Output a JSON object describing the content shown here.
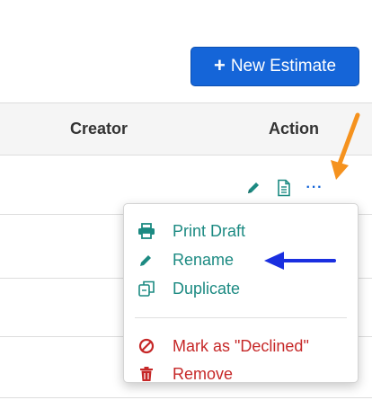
{
  "toolbar": {
    "new_estimate_label": "New Estimate",
    "new_estimate_icon": "plus-icon",
    "accent": "#1565d8"
  },
  "table": {
    "columns": [
      "Creator",
      "Action"
    ]
  },
  "row_actions": {
    "icons": [
      "pencil-icon",
      "document-icon",
      "more-icon"
    ],
    "more_label": "···"
  },
  "dropdown": {
    "items": [
      {
        "label": "Print Draft",
        "icon": "printer-icon",
        "color": "#1c8a82"
      },
      {
        "label": "Rename",
        "icon": "pencil-icon",
        "color": "#1c8a82"
      },
      {
        "label": "Duplicate",
        "icon": "copy-icon",
        "color": "#1c8a82"
      },
      {
        "label": "Mark as \"Declined\"",
        "icon": "prohibited-icon",
        "color": "#c62828"
      },
      {
        "label": "Remove",
        "icon": "trash-icon",
        "color": "#c62828"
      }
    ]
  },
  "annotations": {
    "orange_arrow_color": "#f5921e",
    "blue_arrow_color": "#1a2fe0"
  }
}
